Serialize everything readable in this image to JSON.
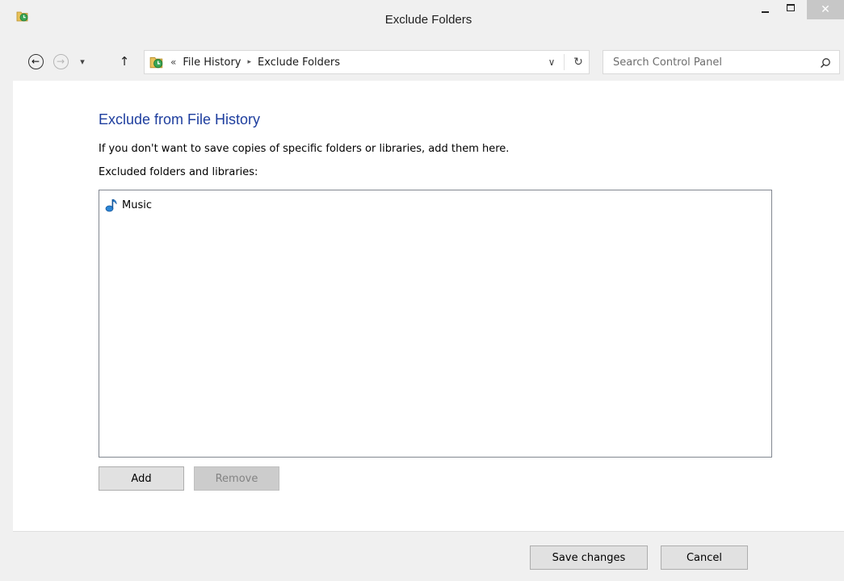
{
  "window": {
    "title": "Exclude Folders",
    "close_glyph": "✕"
  },
  "nav": {
    "back_glyph": "←",
    "forward_glyph": "→",
    "recent_glyph": "▾",
    "up_glyph": "↑",
    "breadcrumb_overflow": "«",
    "breadcrumbs": [
      "File History",
      "Exclude Folders"
    ],
    "crumb_separator": "▸",
    "dropdown_glyph": "∨",
    "refresh_glyph": "↻"
  },
  "search": {
    "placeholder": "Search Control Panel"
  },
  "page": {
    "heading": "Exclude from File History",
    "description": "If you don't want to save copies of specific folders or libraries, add them here.",
    "list_label": "Excluded folders and libraries:",
    "excluded_items": [
      {
        "name": "Music",
        "icon": "music-library-icon"
      }
    ],
    "add_label": "Add",
    "remove_label": "Remove",
    "remove_enabled": false
  },
  "footer": {
    "save_label": "Save changes",
    "cancel_label": "Cancel"
  },
  "colors": {
    "heading": "#1e3e9e",
    "window_bg": "#f0f0f0",
    "content_bg": "#ffffff",
    "close_button_bg": "#c7c7c7"
  }
}
